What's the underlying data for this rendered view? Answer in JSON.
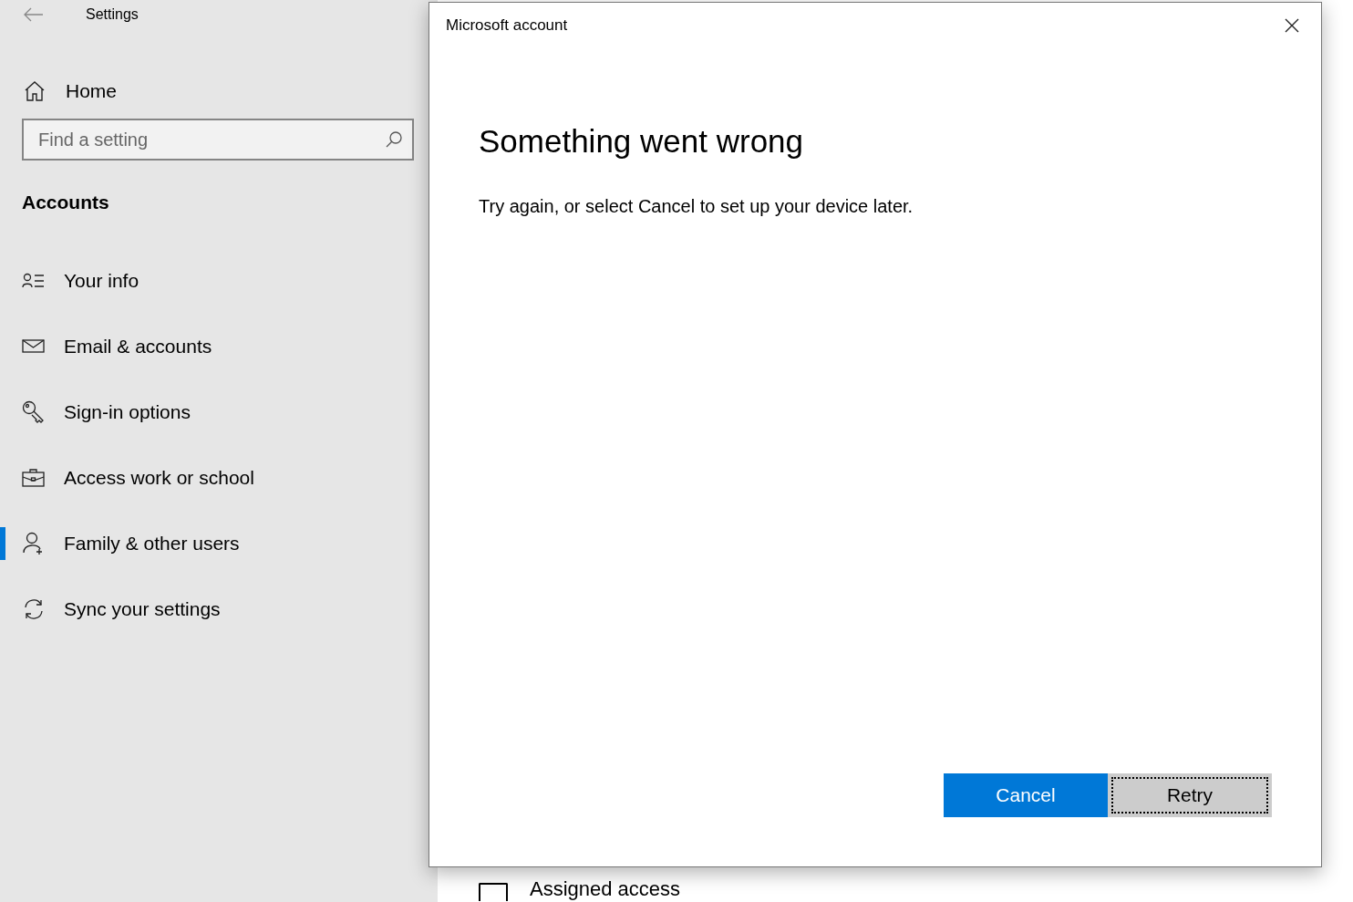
{
  "settings": {
    "title": "Settings",
    "home": "Home",
    "search": {
      "placeholder": "Find a setting"
    },
    "section": "Accounts",
    "nav": [
      {
        "label": "Your info",
        "selected": false
      },
      {
        "label": "Email & accounts",
        "selected": false
      },
      {
        "label": "Sign-in options",
        "selected": false
      },
      {
        "label": "Access work or school",
        "selected": false
      },
      {
        "label": "Family & other users",
        "selected": true
      },
      {
        "label": "Sync your settings",
        "selected": false
      }
    ],
    "content": {
      "option": {
        "label": "Assigned access",
        "checked": false
      }
    }
  },
  "dialog": {
    "title": "Microsoft account",
    "heading": "Something went wrong",
    "message": "Try again, or select Cancel to set up your device later.",
    "buttons": [
      {
        "label": "Cancel",
        "kind": "primary"
      },
      {
        "label": "Retry",
        "kind": "secondary"
      }
    ]
  }
}
